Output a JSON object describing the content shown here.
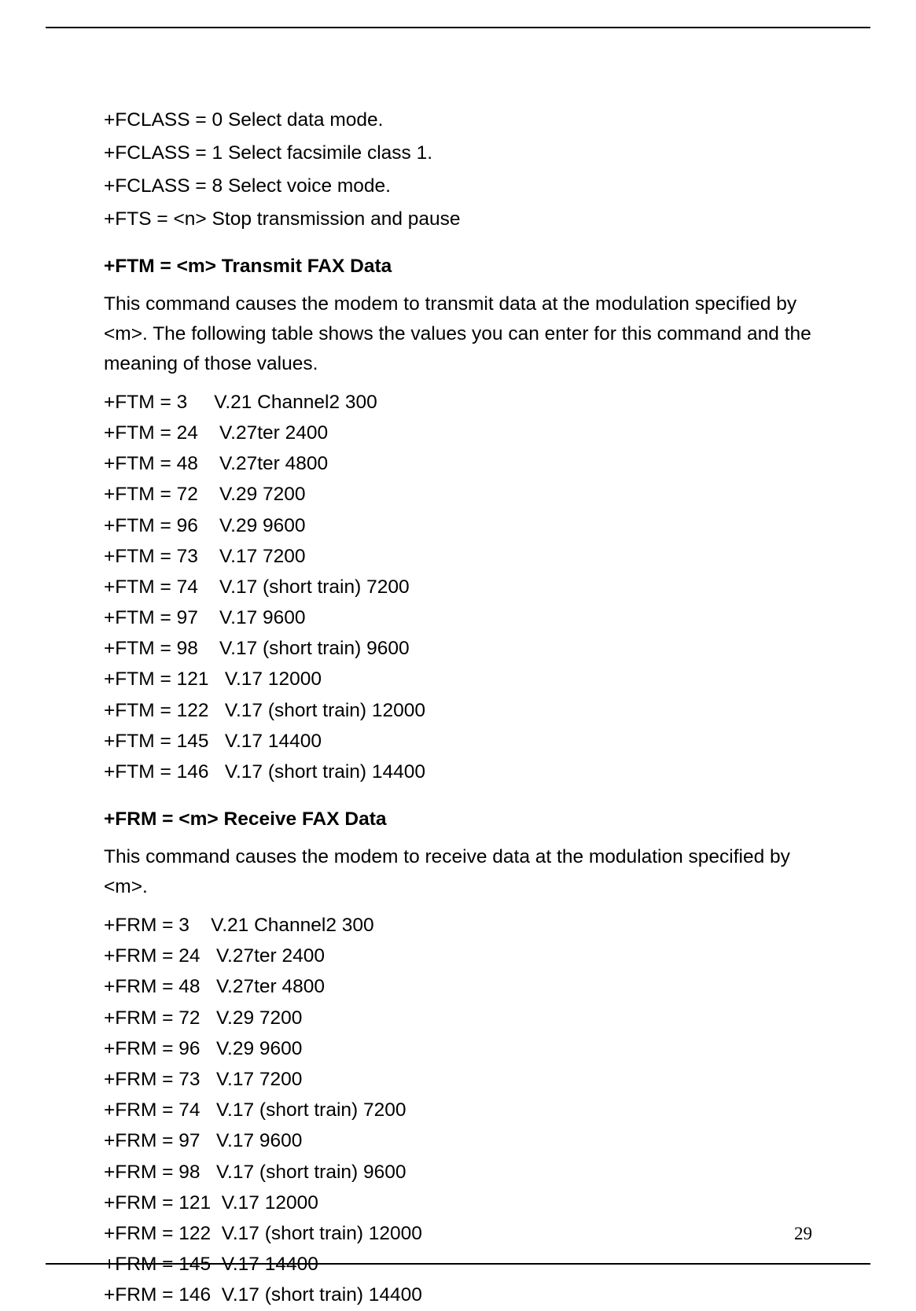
{
  "fclass_lines": [
    "+FCLASS = 0 Select data mode.",
    "+FCLASS = 1 Select facsimile class 1.",
    "+FCLASS = 8 Select voice mode.",
    "+FTS = <n> Stop transmission and pause"
  ],
  "ftm": {
    "heading": "+FTM = <m> Transmit FAX Data",
    "body": "This command causes the modem to transmit data at the modulation specified by <m>. The following table shows the values you can enter for this command and the meaning of those values.",
    "rows": [
      {
        "cmd": "+FTM = 3",
        "desc": "V.21 Channel2 300"
      },
      {
        "cmd": "+FTM = 24",
        "desc": "V.27ter 2400"
      },
      {
        "cmd": "+FTM = 48",
        "desc": "V.27ter 4800"
      },
      {
        "cmd": "+FTM = 72",
        "desc": "V.29 7200"
      },
      {
        "cmd": "+FTM = 96",
        "desc": "V.29 9600"
      },
      {
        "cmd": "+FTM = 73",
        "desc": "V.17 7200"
      },
      {
        "cmd": "+FTM = 74",
        "desc": "V.17 (short train) 7200"
      },
      {
        "cmd": "+FTM = 97",
        "desc": "V.17 9600"
      },
      {
        "cmd": "+FTM = 98",
        "desc": "V.17 (short train) 9600"
      },
      {
        "cmd": "+FTM = 121",
        "desc": "V.17 12000"
      },
      {
        "cmd": "+FTM = 122",
        "desc": "V.17 (short train) 12000"
      },
      {
        "cmd": "+FTM = 145",
        "desc": "V.17 14400"
      },
      {
        "cmd": "+FTM = 146",
        "desc": "V.17 (short train) 14400"
      }
    ]
  },
  "frm": {
    "heading": "+FRM = <m> Receive FAX Data",
    "body": "This command causes the modem to receive data at the modulation specified by <m>.",
    "rows": [
      {
        "cmd": "+FRM = 3",
        "desc": "V.21 Channel2 300"
      },
      {
        "cmd": "+FRM = 24",
        "desc": "V.27ter 2400"
      },
      {
        "cmd": "+FRM = 48",
        "desc": "V.27ter 4800"
      },
      {
        "cmd": "+FRM = 72",
        "desc": "V.29 7200"
      },
      {
        "cmd": "+FRM = 96",
        "desc": "V.29 9600"
      },
      {
        "cmd": "+FRM = 73",
        "desc": "V.17 7200"
      },
      {
        "cmd": "+FRM = 74",
        "desc": "V.17 (short train) 7200"
      },
      {
        "cmd": "+FRM = 97",
        "desc": "V.17 9600"
      },
      {
        "cmd": "+FRM = 98",
        "desc": "V.17 (short train) 9600"
      },
      {
        "cmd": "+FRM = 121",
        "desc": "V.17 12000"
      },
      {
        "cmd": "+FRM = 122",
        "desc": "V.17 (short train) 12000"
      },
      {
        "cmd": "+FRM = 145",
        "desc": "V.17 14400"
      },
      {
        "cmd": "+FRM = 146",
        "desc": "V.17 (short train) 14400"
      }
    ]
  },
  "page_number": "29"
}
